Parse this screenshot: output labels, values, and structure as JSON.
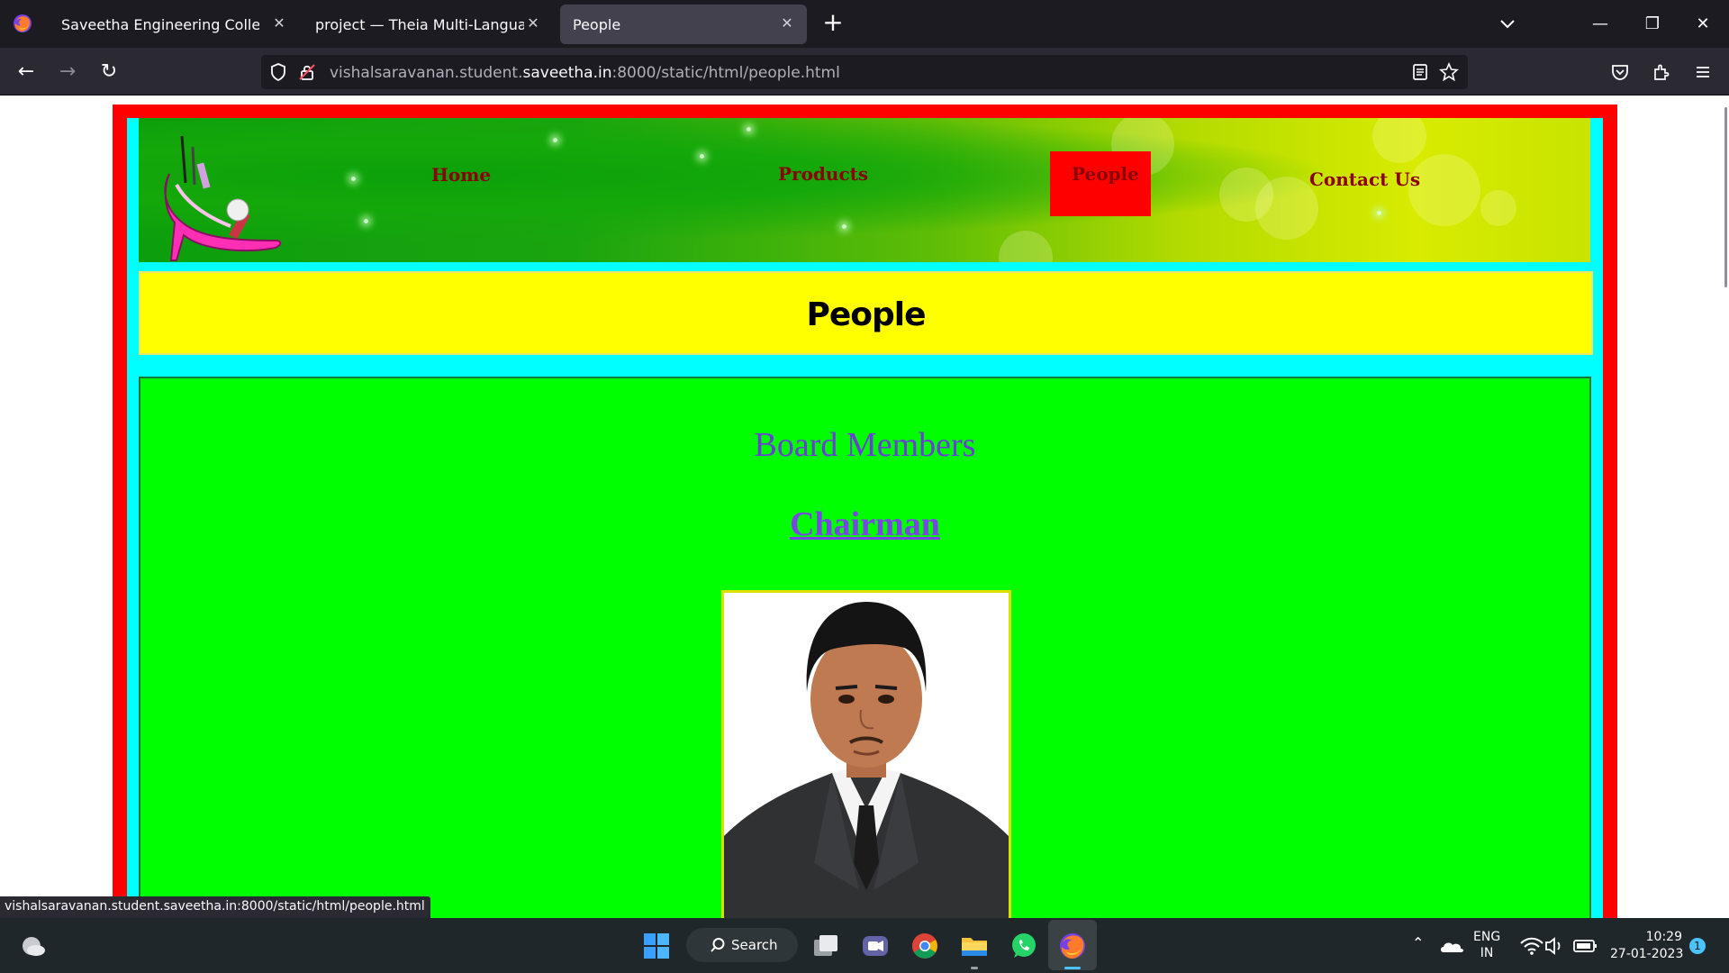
{
  "browser": {
    "tabs": [
      {
        "title": "Saveetha Engineering College",
        "active": false
      },
      {
        "title": "project — Theia Multi-Language Ex",
        "active": false
      },
      {
        "title": "People",
        "active": true
      }
    ],
    "url_prefix": "vishalsaravanan.student.",
    "url_domain": "saveetha.in",
    "url_suffix": ":8000/static/html/people.html",
    "status_url": "vishalsaravanan.student.saveetha.in:8000/static/html/people.html"
  },
  "site": {
    "nav": {
      "home": "Home",
      "products": "Products",
      "people": "People",
      "contact": "Contact Us",
      "active": "People",
      "active_color": "#ff0000",
      "link_color": "#8b0000"
    },
    "page_title": "People",
    "section_heading": "Board Members",
    "role_heading": "Chairman",
    "colors": {
      "outer_border": "#ff0000",
      "inner_border": "#00ffff",
      "title_band": "#ffff00",
      "content_bg": "#00ff00"
    }
  },
  "taskbar": {
    "search_label": "Search",
    "lang_top": "ENG",
    "lang_bottom": "IN",
    "time": "10:29",
    "date": "27-01-2023",
    "notification_count": "1"
  }
}
